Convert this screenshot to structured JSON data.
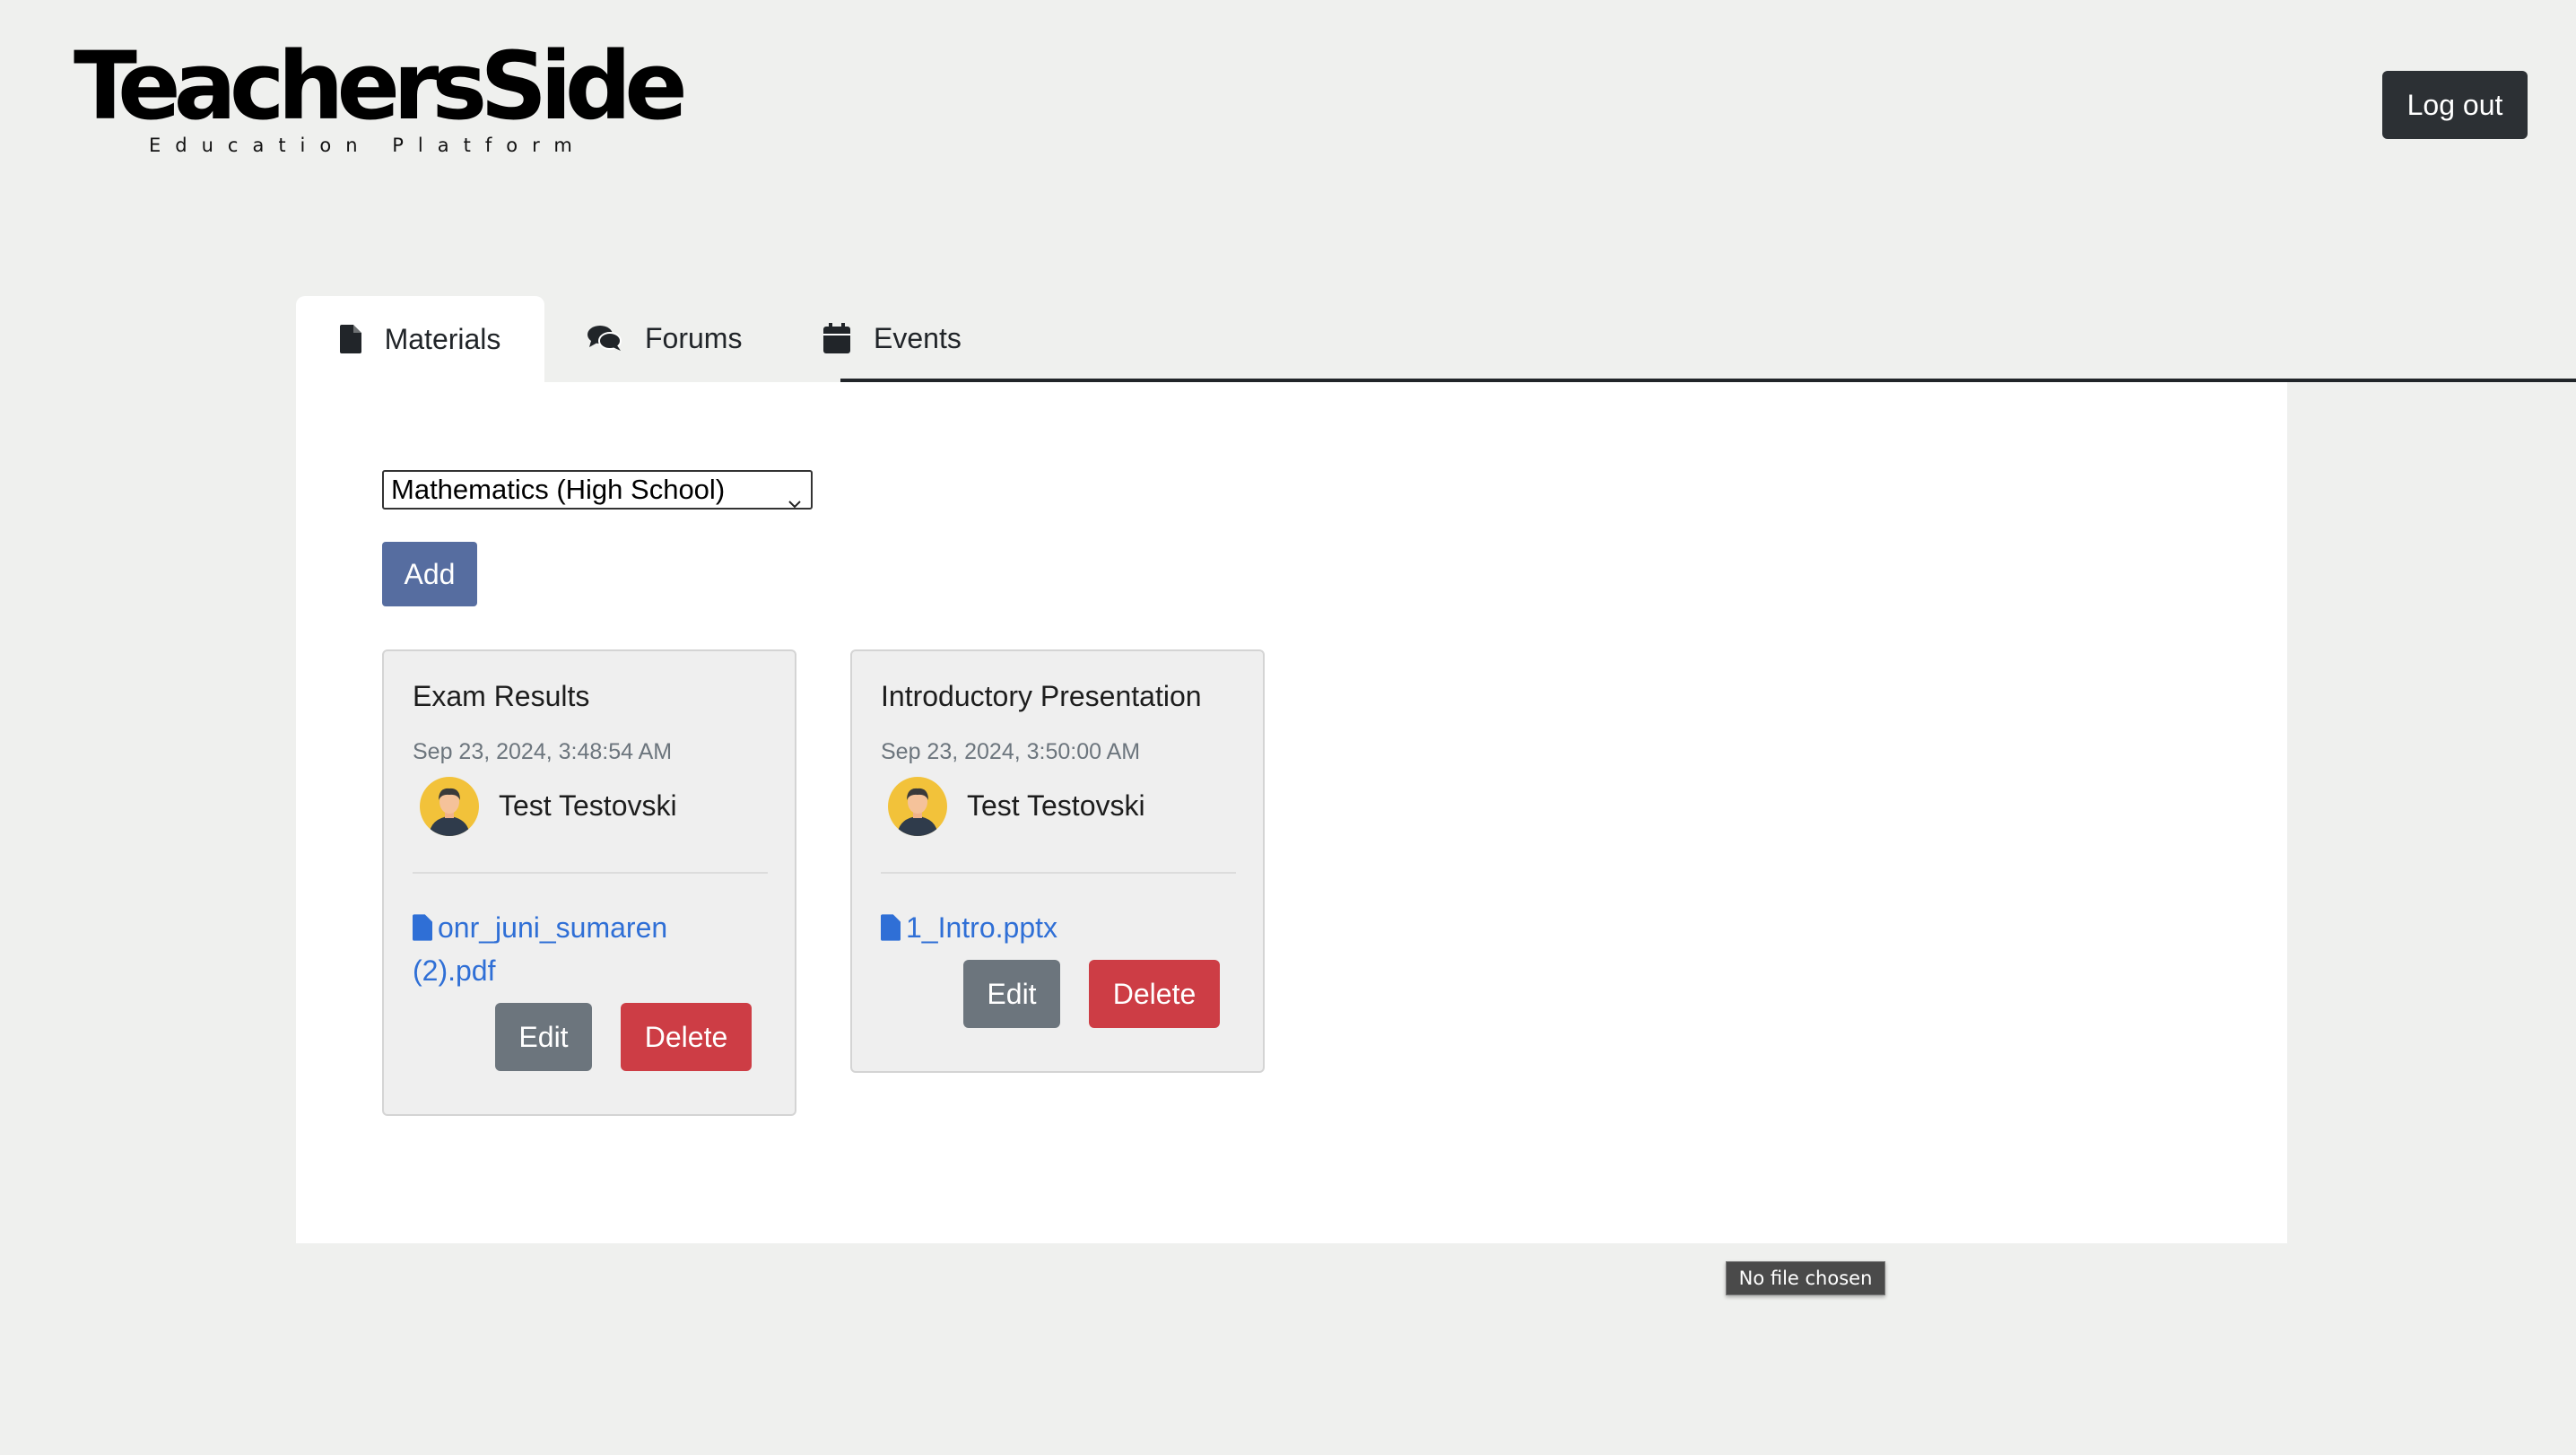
{
  "header": {
    "logo_title": "TeachersSide",
    "logo_subtitle": "Education Platform",
    "logout_label": "Log out"
  },
  "tabs": [
    {
      "label": "Materials",
      "icon": "file-icon",
      "active": true
    },
    {
      "label": "Forums",
      "icon": "comments-icon",
      "active": false
    },
    {
      "label": "Events",
      "icon": "calendar-icon",
      "active": false
    }
  ],
  "materials": {
    "subject_selected": "Mathematics (High School)",
    "add_label": "Add",
    "cards": [
      {
        "title": "Exam Results",
        "date": "Sep 23, 2024, 3:48:54 AM",
        "author": "Test Testovski",
        "file": "onr_juni_sumaren (2).pdf",
        "edit_label": "Edit",
        "delete_label": "Delete"
      },
      {
        "title": "Introductory Presentation",
        "date": "Sep 23, 2024, 3:50:00 AM",
        "author": "Test Testovski",
        "file": "1_Intro.pptx",
        "edit_label": "Edit",
        "delete_label": "Delete"
      }
    ]
  },
  "tooltip": "No file chosen",
  "colors": {
    "background": "#eff0ee",
    "add_button": "#566da0",
    "edit_button": "#6c757d",
    "delete_button": "#cd3d45",
    "link": "#2f6fd6",
    "logout_button": "#2c3034"
  }
}
